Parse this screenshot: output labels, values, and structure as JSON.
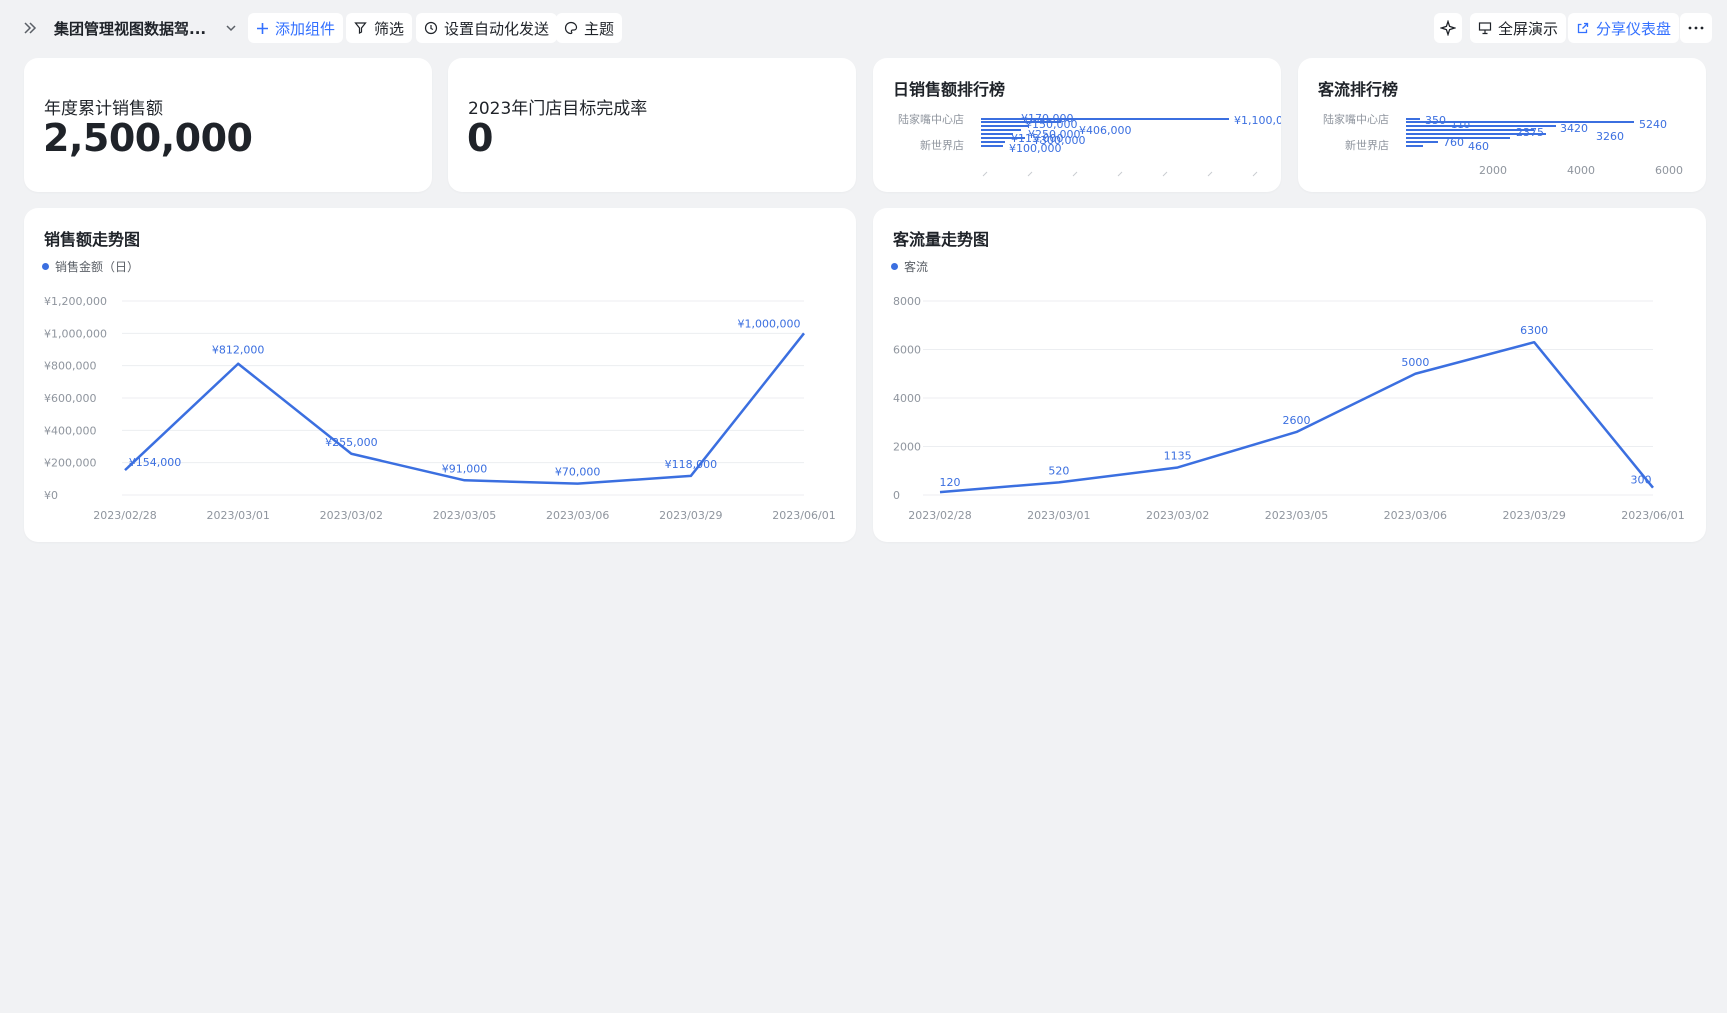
{
  "toolbar": {
    "doc_title": "集团管理视图数据驾...",
    "add_widget": "添加组件",
    "filter": "筛选",
    "auto_send": "设置自动化发送",
    "theme": "主题",
    "fullscreen": "全屏演示",
    "share": "分享仪表盘"
  },
  "kpis": [
    {
      "label": "年度累计销售额",
      "value": "2,500,000"
    },
    {
      "label": "2023年门店目标完成率",
      "value": "0"
    }
  ],
  "rank_sales": {
    "title": "日销售额排行榜",
    "categories": [
      "陆家嘴中心店",
      "新世界店"
    ],
    "value_labels": [
      "¥1,100,0",
      "¥406,000",
      "¥100,000",
      "¥300,000",
      "¥250,000",
      "¥150,000",
      "¥170,000",
      "¥115,000"
    ]
  },
  "rank_traffic": {
    "title": "客流排行榜",
    "categories": [
      "陆家嘴中心店",
      "新世界店"
    ],
    "value_labels": [
      "350",
      "110",
      "5240",
      "2375",
      "3420",
      "3260",
      "760",
      "460"
    ],
    "ticks": [
      "2000",
      "4000",
      "6000"
    ]
  },
  "sales_trend": {
    "title": "销售额走势图",
    "legend": "销售金额（日）",
    "y_ticks": [
      "¥1,200,000",
      "¥1,000,000",
      "¥800,000",
      "¥600,000",
      "¥400,000",
      "¥200,000",
      "¥0"
    ]
  },
  "traffic_trend": {
    "title": "客流量走势图",
    "legend": "客流",
    "y_ticks": [
      "8000",
      "6000",
      "4000",
      "2000",
      "0"
    ]
  },
  "chart_data": [
    {
      "type": "line",
      "title": "销售额走势图",
      "x": [
        "2023/02/28",
        "2023/03/01",
        "2023/03/02",
        "2023/03/05",
        "2023/03/06",
        "2023/03/29",
        "2023/06/01"
      ],
      "series": [
        {
          "name": "销售金额（日）",
          "values": [
            154000,
            812000,
            255000,
            91000,
            70000,
            118000,
            1000000
          ]
        }
      ],
      "labels": [
        "¥154,000",
        "¥812,000",
        "¥255,000",
        "¥91,000",
        "¥70,000",
        "¥118,000",
        "¥1,000,000"
      ],
      "ylim": [
        0,
        1200000
      ],
      "color": "#3b6fe0"
    },
    {
      "type": "line",
      "title": "客流量走势图",
      "x": [
        "2023/02/28",
        "2023/03/01",
        "2023/03/02",
        "2023/03/05",
        "2023/03/06",
        "2023/03/29",
        "2023/06/01"
      ],
      "series": [
        {
          "name": "客流",
          "values": [
            120,
            520,
            1135,
            2600,
            5000,
            6300,
            300
          ]
        }
      ],
      "labels": [
        "120",
        "520",
        "1135",
        "2600",
        "5000",
        "6300",
        "300"
      ],
      "ylim": [
        0,
        8000
      ],
      "color": "#3b6fe0"
    }
  ]
}
